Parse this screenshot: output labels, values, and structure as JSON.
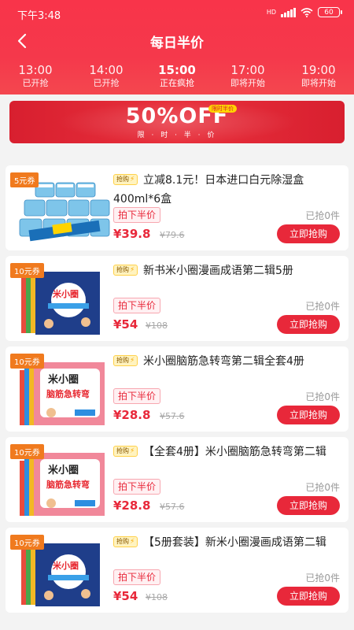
{
  "status_bar": {
    "time": "下午3:48",
    "network": "HD",
    "battery": "60"
  },
  "nav": {
    "title": "每日半价"
  },
  "time_slots": [
    {
      "time": "13:00",
      "status": "已开抢"
    },
    {
      "time": "14:00",
      "status": "已开抢"
    },
    {
      "time": "15:00",
      "status": "正在疯抢"
    },
    {
      "time": "17:00",
      "status": "即将开始"
    },
    {
      "time": "19:00",
      "status": "即将开始"
    }
  ],
  "banner": {
    "headline": "50%OFF",
    "tag": "限时半价",
    "subtitle": "限 · 时 · 半 · 价"
  },
  "tags": {
    "grab": "抢购",
    "half_price": "拍下半价",
    "buy": "立即抢购"
  },
  "products": [
    {
      "coupon": "5元券",
      "title": "立减8.1元！日本进口白元除湿盒400ml*6盒",
      "price": "¥39.8",
      "original": "¥79.6",
      "sold": "已抢0件"
    },
    {
      "coupon": "10元券",
      "title": "新书米小圈漫画成语第二辑5册",
      "price": "¥54",
      "original": "¥108",
      "sold": "已抢0件"
    },
    {
      "coupon": "10元券",
      "title": "米小圈脑筋急转弯第二辑全套4册",
      "price": "¥28.8",
      "original": "¥57.6",
      "sold": "已抢0件"
    },
    {
      "coupon": "10元券",
      "title": "【全套4册】米小圈脑筋急转弯第二辑",
      "price": "¥28.8",
      "original": "¥57.6",
      "sold": "已抢0件"
    },
    {
      "coupon": "10元券",
      "title": "【5册套装】新米小圈漫画成语第二辑",
      "price": "¥54",
      "original": "¥108",
      "sold": "已抢0件"
    }
  ],
  "colors": {
    "brand_red": "#f5384b",
    "price_red": "#e8283a",
    "coupon_orange": "#f07a1e"
  }
}
